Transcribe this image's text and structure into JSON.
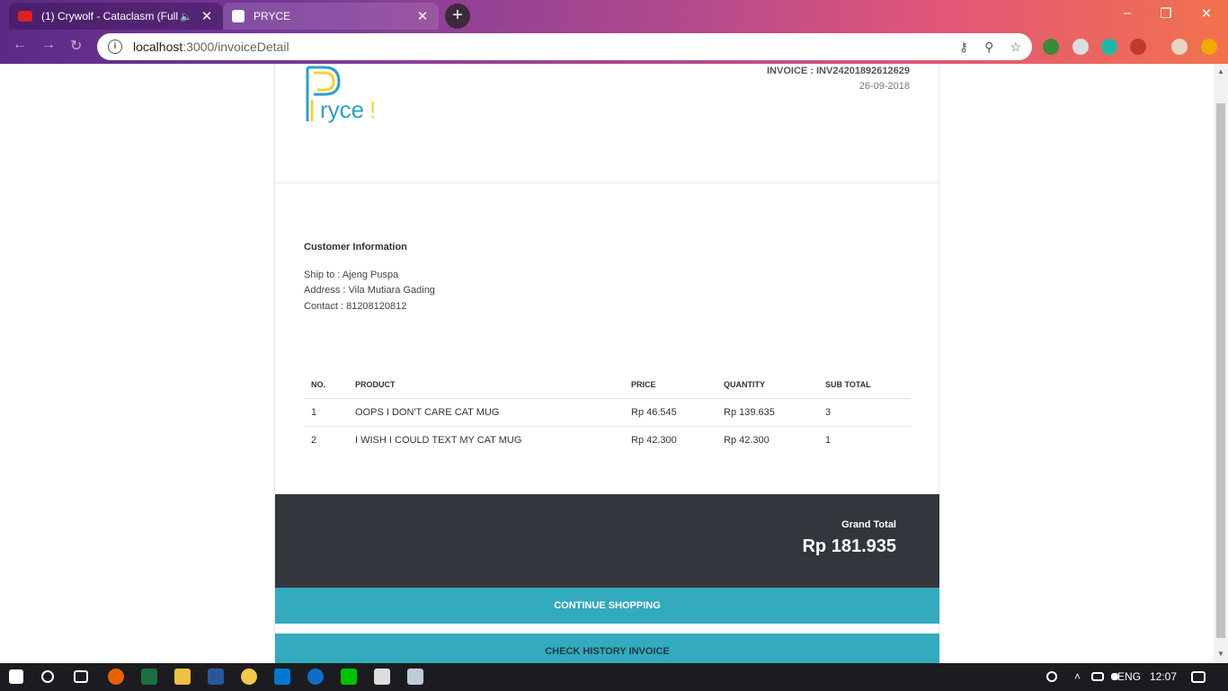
{
  "browser": {
    "tabs": [
      {
        "title": "(1) Crywolf - Cataclasm (Full",
        "active": false
      },
      {
        "title": "PRYCE",
        "active": true
      }
    ],
    "url_host": "localhost",
    "url_path": ":3000/invoiceDetail"
  },
  "invoice": {
    "logo_text": "Pryce!",
    "number": "INVOICE : INV24201892612629",
    "date": "26-09-2018"
  },
  "customer": {
    "heading": "Customer Information",
    "ship_to": "Ship to : Ajeng Puspa",
    "address": "Address : Vila Mutiara Gading",
    "contact": "Contact : 81208120812"
  },
  "table": {
    "headers": [
      "NO.",
      "PRODUCT",
      "PRICE",
      "QUANTITY",
      "SUB TOTAL"
    ],
    "rows": [
      [
        "1",
        "OOPS I DON'T CARE CAT MUG",
        "Rp 46.545",
        "Rp 139.635",
        "3"
      ],
      [
        "2",
        "I WISH I COULD TEXT MY CAT MUG",
        "Rp 42.300",
        "Rp 42.300",
        "1"
      ]
    ]
  },
  "totals": {
    "label": "Grand Total",
    "amount": "Rp 181.935"
  },
  "actions": {
    "continue": "CONTINUE SHOPPING",
    "history": "CHECK HISTORY INVOICE"
  },
  "taskbar": {
    "lang": "ENG",
    "time": "12:07"
  },
  "colors": {
    "accent": "#33aabd",
    "dark_panel": "#33373d",
    "logo_blue": "#2e9fc2",
    "logo_yellow": "#f2d335"
  }
}
